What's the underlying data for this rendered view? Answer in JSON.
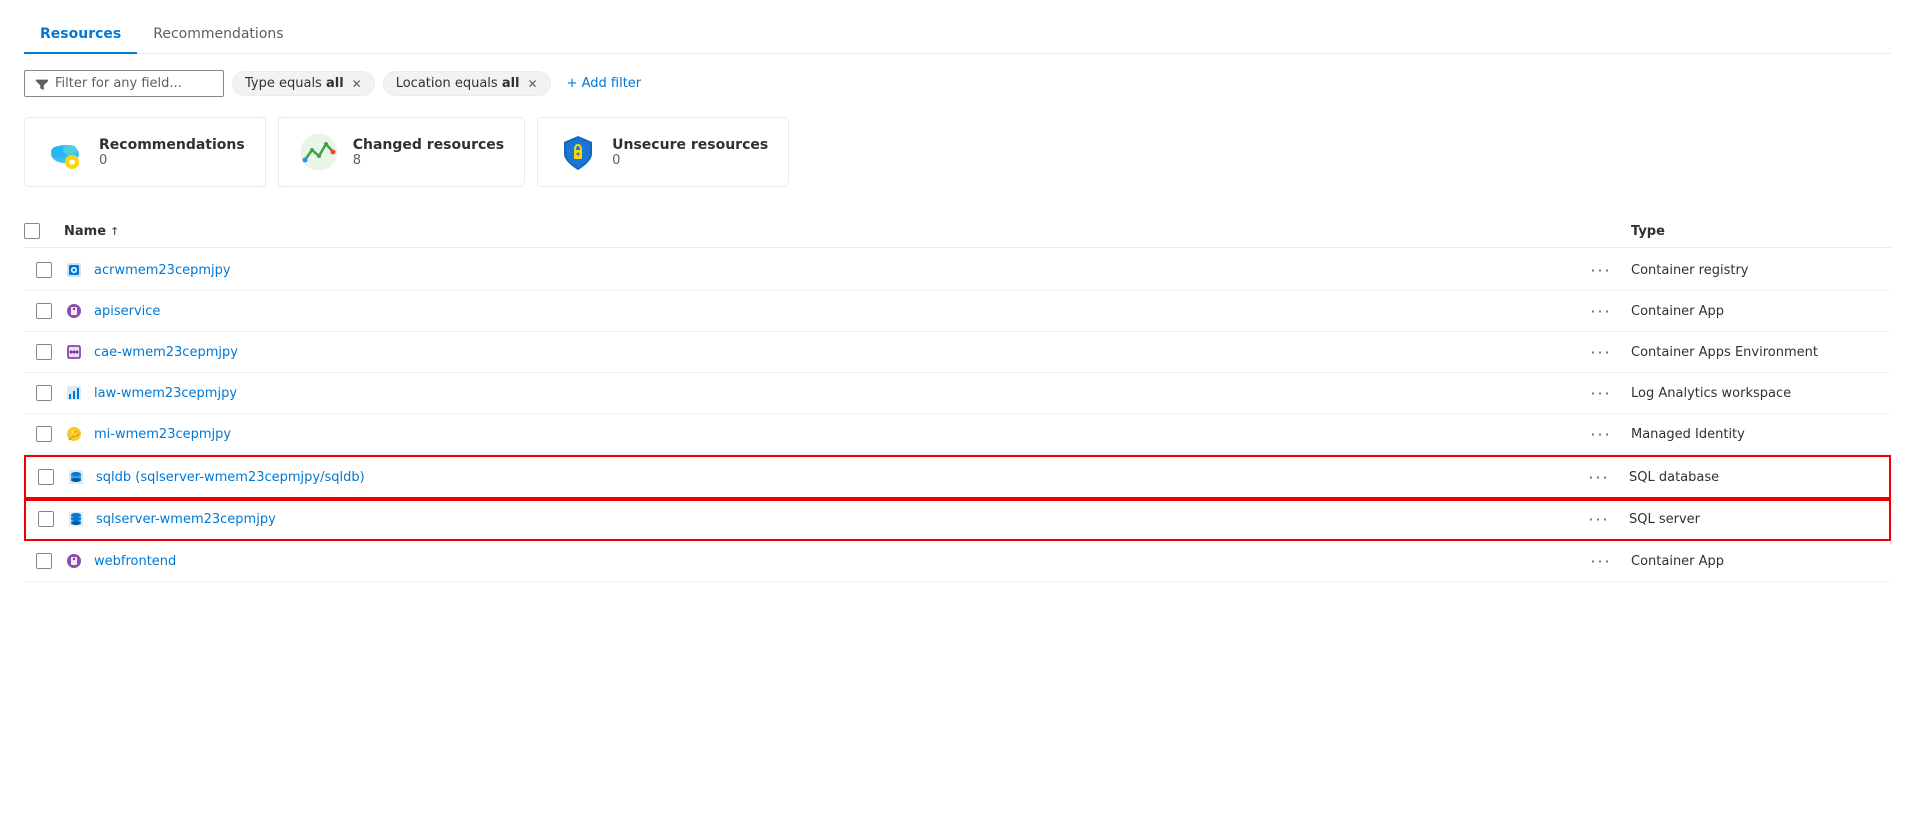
{
  "tabs": [
    {
      "label": "Resources",
      "active": true
    },
    {
      "label": "Recommendations",
      "active": false
    }
  ],
  "filters": {
    "placeholder": "Filter for any field...",
    "chips": [
      {
        "label": "Type equals ",
        "bold": "all"
      },
      {
        "label": "Location equals ",
        "bold": "all"
      }
    ],
    "add_filter_label": "+ Add filter"
  },
  "summary_cards": [
    {
      "title": "Recommendations",
      "count": "0",
      "icon": "recommendations"
    },
    {
      "title": "Changed resources",
      "count": "8",
      "icon": "changed"
    },
    {
      "title": "Unsecure resources",
      "count": "0",
      "icon": "unsecure"
    }
  ],
  "table": {
    "col_name": "Name",
    "col_type": "Type",
    "sort_indicator": "↑",
    "rows": [
      {
        "name": "acrwmem23cepmjpy",
        "type": "Container registry",
        "icon": "container-registry",
        "highlighted": false
      },
      {
        "name": "apiservice",
        "type": "Container App",
        "icon": "container-app",
        "highlighted": false
      },
      {
        "name": "cae-wmem23cepmjpy",
        "type": "Container Apps Environment",
        "icon": "container-apps-env",
        "highlighted": false
      },
      {
        "name": "law-wmem23cepmjpy",
        "type": "Log Analytics workspace",
        "icon": "log-analytics",
        "highlighted": false
      },
      {
        "name": "mi-wmem23cepmjpy",
        "type": "Managed Identity",
        "icon": "managed-identity",
        "highlighted": false
      },
      {
        "name": "sqldb (sqlserver-wmem23cepmjpy/sqldb)",
        "type": "SQL database",
        "icon": "sql-db",
        "highlighted": true
      },
      {
        "name": "sqlserver-wmem23cepmjpy",
        "type": "SQL server",
        "icon": "sql-server",
        "highlighted": true
      },
      {
        "name": "webfrontend",
        "type": "Container App",
        "icon": "container-app",
        "highlighted": false
      }
    ]
  }
}
